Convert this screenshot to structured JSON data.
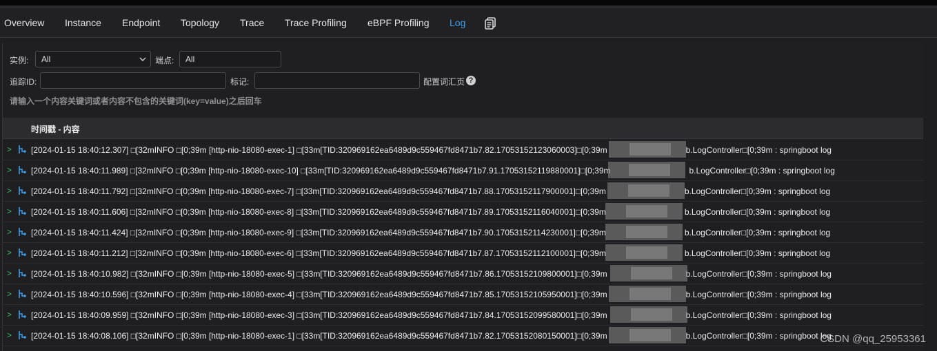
{
  "tabs": [
    {
      "label": "Overview",
      "active": false
    },
    {
      "label": "Instance",
      "active": false
    },
    {
      "label": "Endpoint",
      "active": false
    },
    {
      "label": "Topology",
      "active": false
    },
    {
      "label": "Trace",
      "active": false
    },
    {
      "label": "Trace Profiling",
      "active": false
    },
    {
      "label": "eBPF Profiling",
      "active": false
    },
    {
      "label": "Log",
      "active": true
    }
  ],
  "toolbar_icon": "copy-dashboard-icon",
  "filters": {
    "instance_label": "实例:",
    "instance_value": "All",
    "endpoint_label": "端点:",
    "endpoint_value": "All",
    "trace_id_label": "追踪ID:",
    "trace_id_value": "",
    "tag_label": "标记:",
    "tag_value": "",
    "config_label": "配置词汇页",
    "help_glyph": "?",
    "hint": "请输入一个内容关键词或者内容不包含的关键词(key=value)之后回车"
  },
  "table": {
    "header": "时间戳 - 内容"
  },
  "logs": [
    {
      "left": "[2024-01-15 18:40:12.307] □[32mINFO □[0;39m [http-nio-18080-exec-1] □[33m[TID:320969162ea6489d9c559467fd8471b7.82.17053152123060003]□[0;39m",
      "right": "b.LogController□[0;39m : springboot log"
    },
    {
      "left": "[2024-01-15 18:40:11.989] □[32mINFO □[0;39m [http-nio-18080-exec-10] □[33m[TID:320969162ea6489d9c559467fd8471b7.91.17053152119880001]□[0;39m",
      "right": "b.LogController□[0;39m : springboot log"
    },
    {
      "left": "[2024-01-15 18:40:11.792] □[32mINFO □[0;39m [http-nio-18080-exec-7] □[33m[TID:320969162ea6489d9c559467fd8471b7.88.17053152117900001]□[0;39m",
      "right": "b.LogController□[0;39m : springboot log"
    },
    {
      "left": "[2024-01-15 18:40:11.606] □[32mINFO □[0;39m [http-nio-18080-exec-8] □[33m[TID:320969162ea6489d9c559467fd8471b7.89.17053152116040001]□[0;39m",
      "right": "b.LogController□[0;39m : springboot log"
    },
    {
      "left": "[2024-01-15 18:40:11.424] □[32mINFO □[0;39m [http-nio-18080-exec-9] □[33m[TID:320969162ea6489d9c559467fd8471b7.90.17053152114230001]□[0;39m",
      "right": "b.LogController□[0;39m : springboot log"
    },
    {
      "left": "[2024-01-15 18:40:11.212] □[32mINFO □[0;39m [http-nio-18080-exec-6] □[33m[TID:320969162ea6489d9c559467fd8471b7.87.17053152112100001]□[0;39m",
      "right": "b.LogController□[0;39m : springboot log"
    },
    {
      "left": "[2024-01-15 18:40:10.982] □[32mINFO □[0;39m [http-nio-18080-exec-5] □[33m[TID:320969162ea6489d9c559467fd8471b7.86.17053152109800001]□[0;39m",
      "right": "b.LogController□[0;39m : springboot log"
    },
    {
      "left": "[2024-01-15 18:40:10.596] □[32mINFO □[0;39m [http-nio-18080-exec-4] □[33m[TID:320969162ea6489d9c559467fd8471b7.85.17053152105950001]□[0;39m",
      "right": "b.LogController□[0;39m : springboot log"
    },
    {
      "left": "[2024-01-15 18:40:09.959] □[32mINFO □[0;39m [http-nio-18080-exec-3] □[33m[TID:320969162ea6489d9c559467fd8471b7.84.17053152099580001]□[0;39m",
      "right": "b.LogController□[0;39m : springboot log"
    },
    {
      "left": "[2024-01-15 18:40:08.106] □[32mINFO □[0;39m [http-nio-18080-exec-1] □[33m[TID:320969162ea6489d9c559467fd8471b7.82.17053152080150001]□[0;39m",
      "right": "b.LogController□[0;39m : springboot log"
    }
  ],
  "watermark": "CSDN @qq_25953361",
  "colors": {
    "accent": "#3f9dea",
    "expand": "#3fb86a",
    "background": "#1e1e20"
  }
}
